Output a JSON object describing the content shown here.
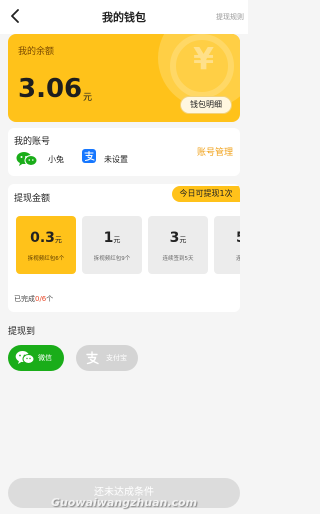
{
  "nav": {
    "title": "我的钱包",
    "rule_link": "提现规则"
  },
  "balance": {
    "label": "我的余额",
    "amount": "3.06",
    "unit": "元",
    "detail_button": "钱包明细",
    "deco_symbol": "¥"
  },
  "account": {
    "header": "我的账号",
    "wechat_name": "小兔",
    "alipay_status": "未设置",
    "manage_link": "账号管理"
  },
  "withdraw": {
    "header": "提现金额",
    "today_badge": "今日可提现1次",
    "options": [
      {
        "value": "0.3",
        "unit": "元",
        "sub": "拆视频红包6个",
        "selected": true
      },
      {
        "value": "1",
        "unit": "元",
        "sub": "拆视频红包9个",
        "selected": false
      },
      {
        "value": "3",
        "unit": "元",
        "sub": "连续签到5天",
        "selected": false
      },
      {
        "value": "5",
        "unit": "",
        "sub": "连",
        "selected": false
      }
    ],
    "progress_prefix": "已完成",
    "progress_value": "0/6",
    "progress_suffix": "个"
  },
  "withdraw_to": {
    "label": "提现到",
    "wechat": "微信",
    "alipay": "支付宝"
  },
  "bottom_button": "还未达成条件",
  "watermark": "Guowaiwangzhuan.com",
  "colors": {
    "accent": "#ffc21a",
    "wechat_green": "#1aad19",
    "link_orange": "#f0a21b",
    "progress_red": "#e84a2a"
  }
}
